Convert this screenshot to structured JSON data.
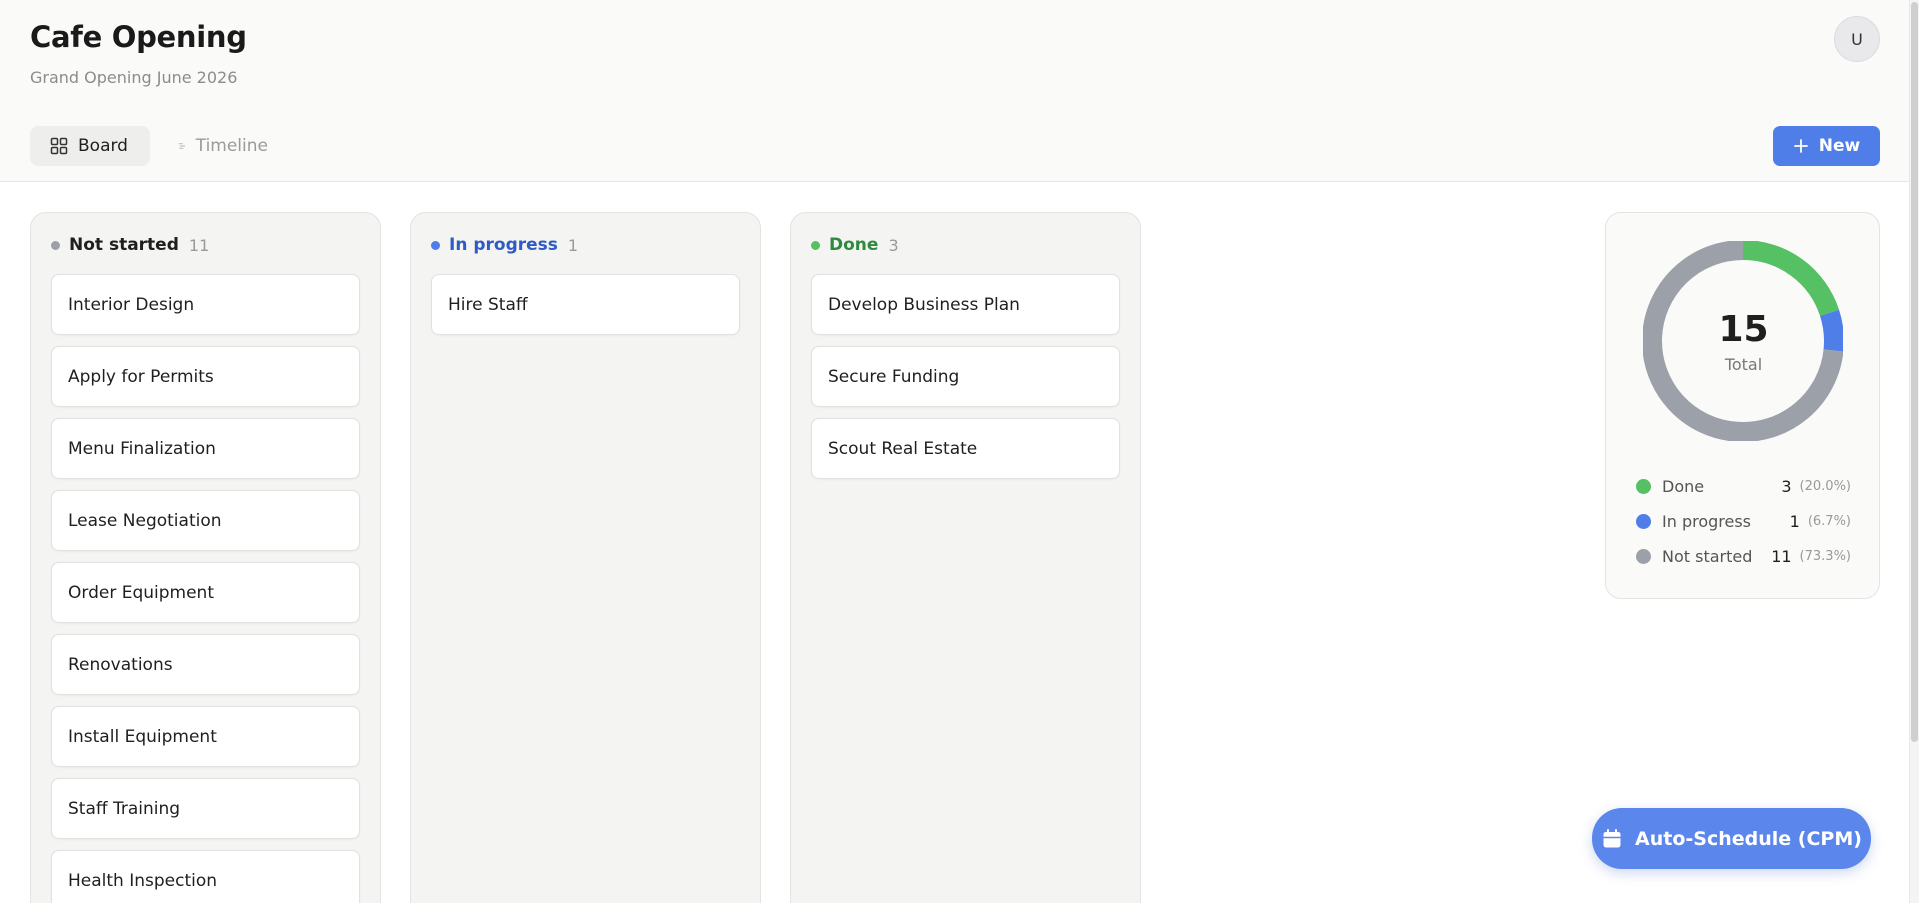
{
  "header": {
    "title": "Cafe Opening",
    "subtitle": "Grand Opening June 2026",
    "avatar_initial": "U",
    "tabs": [
      {
        "label": "Board",
        "active": true,
        "icon": "grid-icon"
      },
      {
        "label": "Timeline",
        "active": false,
        "icon": "timeline-icon"
      }
    ],
    "new_button_label": "New"
  },
  "columns": [
    {
      "title": "Not started",
      "count": "11",
      "color": "#9ca0a8",
      "title_color": "#1f1f1f",
      "cards": [
        "Interior Design",
        "Apply for Permits",
        "Menu Finalization",
        "Lease Negotiation",
        "Order Equipment",
        "Renovations",
        "Install Equipment",
        "Staff Training",
        "Health Inspection"
      ]
    },
    {
      "title": "In progress",
      "count": "1",
      "color": "#4f7ee8",
      "title_color": "#2f5bc4",
      "cards": [
        "Hire Staff"
      ]
    },
    {
      "title": "Done",
      "count": "3",
      "color": "#56c065",
      "title_color": "#2e8a3e",
      "cards": [
        "Develop Business Plan",
        "Secure Funding",
        "Scout Real Estate"
      ]
    }
  ],
  "summary": {
    "total": "15",
    "total_label": "Total",
    "legend": [
      {
        "label": "Done",
        "count": "3",
        "pct": "(20.0%)",
        "color": "#56c065",
        "value": 3
      },
      {
        "label": "In progress",
        "count": "1",
        "pct": "(6.7%)",
        "color": "#4f7ee8",
        "value": 1
      },
      {
        "label": "Not started",
        "count": "11",
        "pct": "(73.3%)",
        "color": "#9ca0a8",
        "value": 11
      }
    ]
  },
  "auto_schedule_label": "Auto-Schedule (CPM)"
}
